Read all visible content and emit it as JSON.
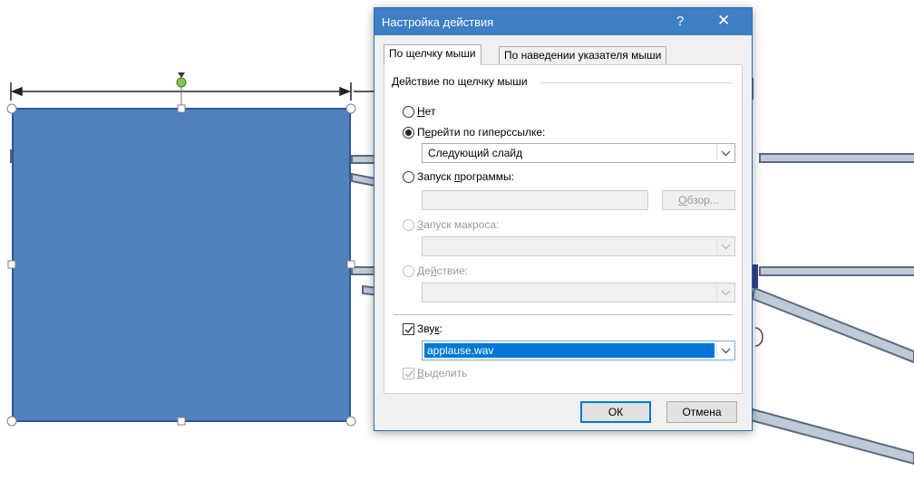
{
  "dialog": {
    "title": "Настройка действия",
    "help_glyph": "?",
    "close_glyph": "✕",
    "tabs": [
      "По щелчку мыши",
      "По наведении указателя мыши"
    ],
    "group_label": "Действие по щелчку мыши",
    "options": {
      "none": {
        "label": "Нет",
        "key": "Н",
        "rest": "ет"
      },
      "hyperlink": {
        "label_pre": "П",
        "key": "е",
        "rest": "рейти по гиперссылке:",
        "selected": true
      },
      "hyperlink_value": "Следующий слайд",
      "program": {
        "pre": "Запуск ",
        "key": "п",
        "rest": "рограммы:"
      },
      "browse_pre": "",
      "browse_key": "О",
      "browse_rest": "бзор...",
      "macro": {
        "key": "З",
        "rest": "апуск макроса:"
      },
      "action": {
        "pre": "Де",
        "key": "й",
        "rest": "ствие:"
      }
    },
    "sound": {
      "pre": "Зву",
      "key": "к",
      "rest": ":",
      "checked": true,
      "value": "applause.wav"
    },
    "highlight": {
      "key": "В",
      "rest": "ыделить",
      "checked": true
    },
    "buttons": {
      "ok": "ОК",
      "cancel": "Отмена"
    }
  },
  "colors": {
    "shape_fill": "#4f81bd",
    "title_bar": "#3d7fc4",
    "selection": "#0078d7"
  }
}
